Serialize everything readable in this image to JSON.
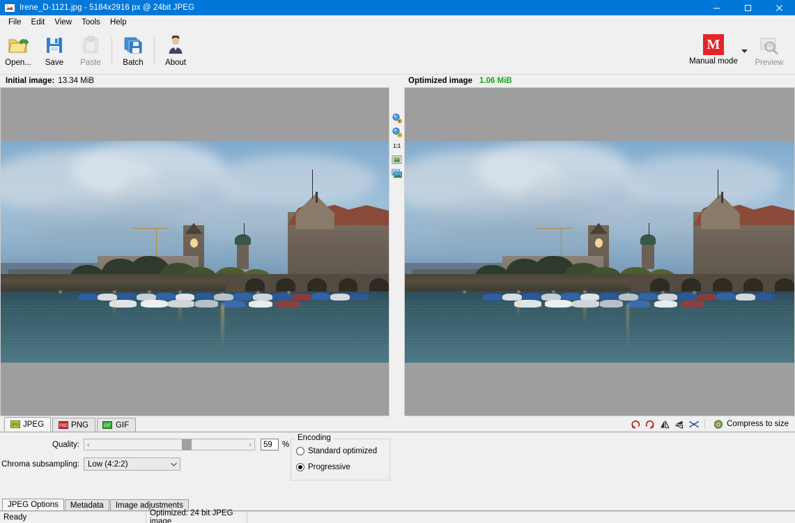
{
  "window": {
    "title": "Irene_D-1121.jpg - 5184x2916 px @ 24bit JPEG",
    "app_icon": "jpeg-app-icon",
    "minimize": "–",
    "maximize": "☐",
    "close": "✕"
  },
  "menubar": {
    "items": [
      {
        "label": "File",
        "accel": "F"
      },
      {
        "label": "Edit",
        "accel": "E"
      },
      {
        "label": "View",
        "accel": "V"
      },
      {
        "label": "Tools",
        "accel": "T"
      },
      {
        "label": "Help",
        "accel": "H"
      }
    ]
  },
  "toolbar": {
    "buttons": [
      {
        "label": "Open...",
        "icon": "open-folder-icon",
        "enabled": true
      },
      {
        "label": "Save",
        "icon": "floppy-save-icon",
        "enabled": true
      },
      {
        "label": "Paste",
        "icon": "clipboard-paste-icon",
        "enabled": false
      },
      {
        "label": "Batch",
        "icon": "batch-stack-icon",
        "enabled": true
      },
      {
        "label": "About",
        "icon": "person-about-icon",
        "enabled": true
      }
    ],
    "mode": {
      "label": "Manual mode",
      "badge": "M",
      "badge_color": "#e8232a"
    },
    "preview": {
      "label": "Preview",
      "icon": "magnifier-preview-icon",
      "enabled": false
    }
  },
  "image_headers": {
    "initial_label": "Initial image:",
    "initial_size": "13.34 MiB",
    "optimized_label": "Optimized image",
    "optimized_size": "1.06 MiB",
    "optimized_color": "#15a815"
  },
  "view_strip": {
    "icons": [
      {
        "name": "zoom-in-icon",
        "glyph": "zoom-in"
      },
      {
        "name": "zoom-out-icon",
        "glyph": "zoom-out"
      },
      {
        "name": "actual-size-icon",
        "glyph": "1:1"
      },
      {
        "name": "fit-to-window-icon",
        "glyph": "fit"
      },
      {
        "name": "side-by-side-icon",
        "glyph": "compare"
      }
    ]
  },
  "format_tabs": {
    "tabs": [
      {
        "label": "JPEG",
        "icon": "jpeg-format-icon",
        "active": true
      },
      {
        "label": "PNG",
        "icon": "png-format-icon",
        "active": false
      },
      {
        "label": "GIF",
        "icon": "gif-format-icon",
        "active": false
      }
    ],
    "actions": [
      {
        "name": "rotate-left-icon",
        "title": "Rotate left"
      },
      {
        "name": "rotate-right-icon",
        "title": "Rotate right"
      },
      {
        "name": "flip-horizontal-icon",
        "title": "Flip horizontal"
      },
      {
        "name": "flip-vertical-icon",
        "title": "Flip vertical"
      },
      {
        "name": "crop-icon",
        "title": "Crop"
      }
    ],
    "compress_to_size": {
      "label": "Compress to size",
      "icon": "compress-target-icon"
    }
  },
  "jpeg_options": {
    "quality_label": "Quality:",
    "quality_value": "59",
    "quality_percent": "%",
    "quality_min": 0,
    "quality_max": 100,
    "slider_left_arrow": "‹",
    "slider_right_arrow": "›",
    "chroma_label": "Chroma subsampling:",
    "chroma_value": "Low (4:2:2)",
    "chroma_caret": "⌄",
    "encoding_legend": "Encoding",
    "encoding_options": [
      {
        "label": "Standard optimized",
        "selected": false
      },
      {
        "label": "Progressive",
        "selected": true
      }
    ]
  },
  "bottom_tabs": {
    "tabs": [
      {
        "label": "JPEG Options",
        "active": true
      },
      {
        "label": "Metadata",
        "active": false
      },
      {
        "label": "Image adjustments",
        "active": false
      }
    ]
  },
  "statusbar": {
    "cell1": "Ready",
    "cell2": "Optimized: 24 bit JPEG image",
    "cell3": ""
  },
  "photo": {
    "description": "Zurich riverside at dusk with historic building, trees, moored boats and water",
    "sky_top": "#7fa9cc",
    "water_color": "#3d6370",
    "building_color": "#6a5f55",
    "roof_color": "#8a4a3a"
  }
}
